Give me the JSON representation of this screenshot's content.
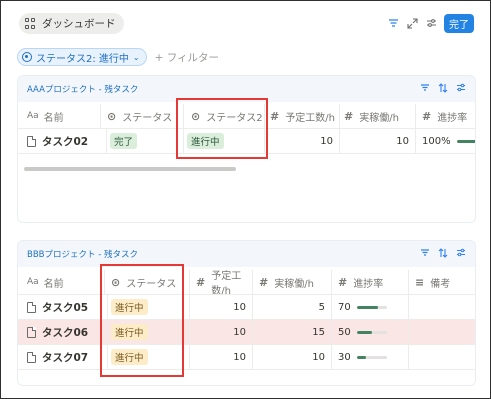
{
  "header": {
    "dashboard_label": "ダッシュボード",
    "done_label": "完了"
  },
  "filters": {
    "chip_label": "ステータス2: 進行中",
    "add_label": "+ フィルター"
  },
  "panel_a": {
    "title": "AAAプロジェクト - 残タスク",
    "columns": [
      "名前",
      "ステータス",
      "ステータス2",
      "予定工数/h",
      "実稼働/h",
      "進捗率"
    ],
    "rows": [
      {
        "name": "タスク02",
        "status": "完了",
        "status2": "進行中",
        "planned": "10",
        "actual": "10",
        "progress": "100%",
        "progress_value": 100
      }
    ]
  },
  "panel_b": {
    "title": "BBBプロジェクト - 残タスク",
    "columns": [
      "名前",
      "ステータス",
      "予定工数/h",
      "実稼働/h",
      "進捗率",
      "備考"
    ],
    "rows": [
      {
        "name": "タスク05",
        "status": "進行中",
        "planned": "10",
        "actual": "5",
        "progress": "70",
        "progress_value": 70
      },
      {
        "name": "タスク06",
        "status": "進行中",
        "planned": "10",
        "actual": "15",
        "progress": "50",
        "progress_value": 50
      },
      {
        "name": "タスク07",
        "status": "進行中",
        "planned": "10",
        "actual": "10",
        "progress": "30",
        "progress_value": 30
      }
    ]
  },
  "colors": {
    "accent": "#2383e2",
    "done_tag_bg": "#dbeddb",
    "progress_tag_bg": "#fdecc8",
    "progress_bar": "#448361",
    "annotation_red": "#e53935",
    "highlight_row": "#fbe6e6"
  }
}
